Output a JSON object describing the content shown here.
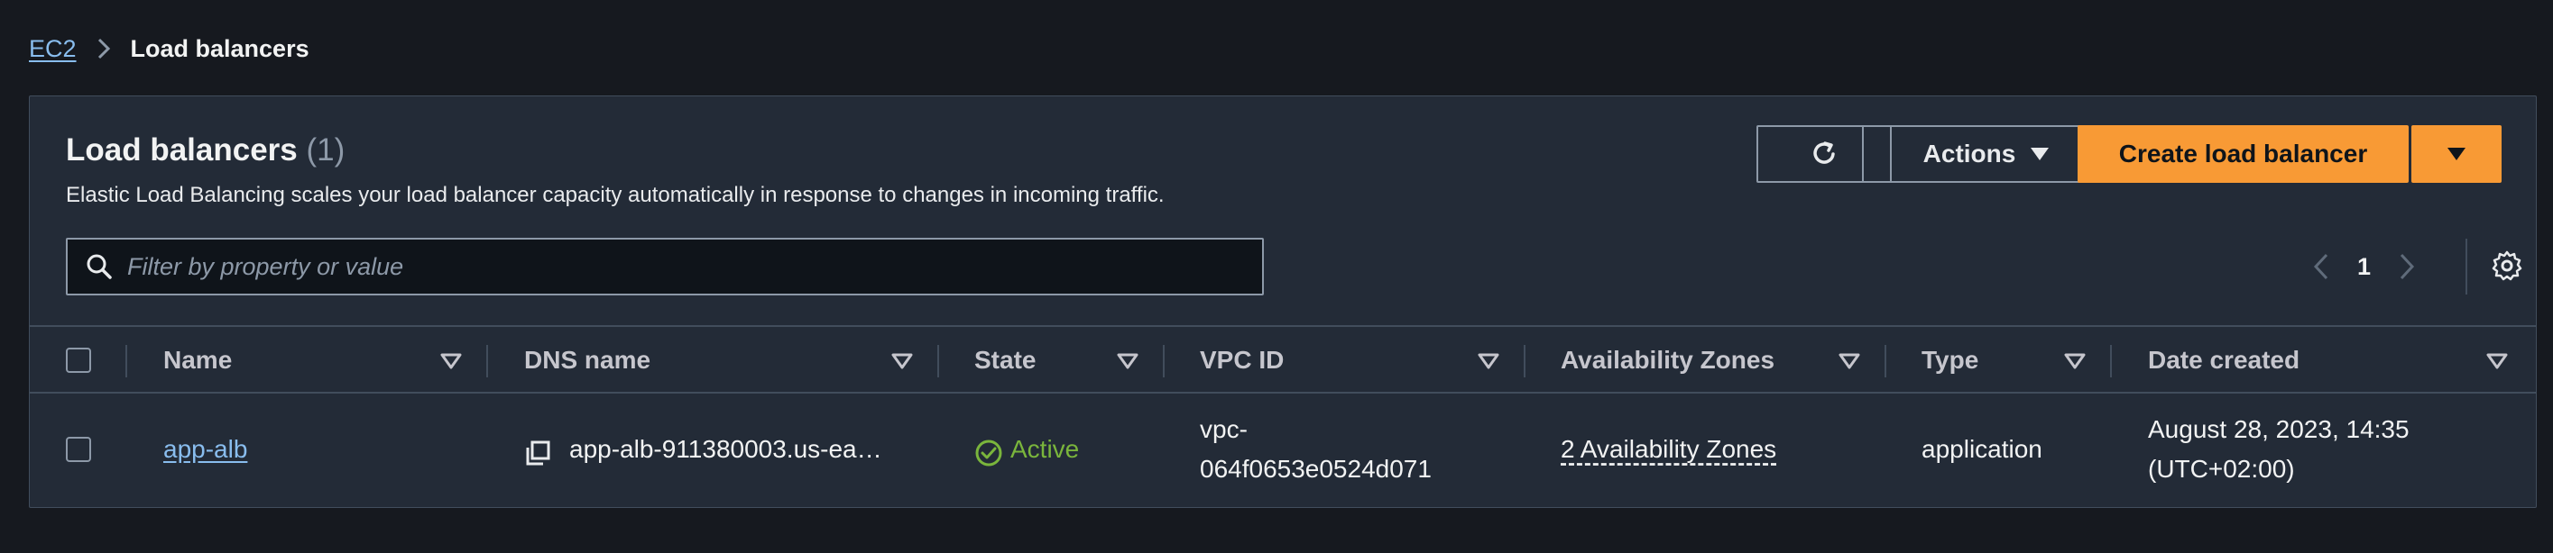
{
  "breadcrumb": {
    "root": "EC2",
    "current": "Load balancers"
  },
  "panel": {
    "title": "Load balancers",
    "count": "(1)",
    "description": "Elastic Load Balancing scales your load balancer capacity automatically in response to changes in incoming traffic."
  },
  "toolbar": {
    "refresh_icon": "refresh-icon",
    "actions_label": "Actions",
    "create_label": "Create load balancer"
  },
  "search": {
    "placeholder": "Filter by property or value"
  },
  "pagination": {
    "current_page": "1"
  },
  "table": {
    "columns": [
      "Name",
      "DNS name",
      "State",
      "VPC ID",
      "Availability Zones",
      "Type",
      "Date created"
    ],
    "rows": [
      {
        "name": "app-alb",
        "dns_name": "app-alb-911380003.us-ea…",
        "state": "Active",
        "vpc_id_line1": "vpc-",
        "vpc_id_line2": "064f0653e0524d071",
        "availability_zones": "2 Availability Zones",
        "type": "application",
        "date_line1": "August 28, 2023, 14:35",
        "date_line2": "(UTC+02:00)"
      }
    ]
  },
  "colors": {
    "background": "#16191f",
    "panel": "#232b37",
    "accent": "#f89a35",
    "link": "#89bdee",
    "status_active": "#7ab53c"
  }
}
